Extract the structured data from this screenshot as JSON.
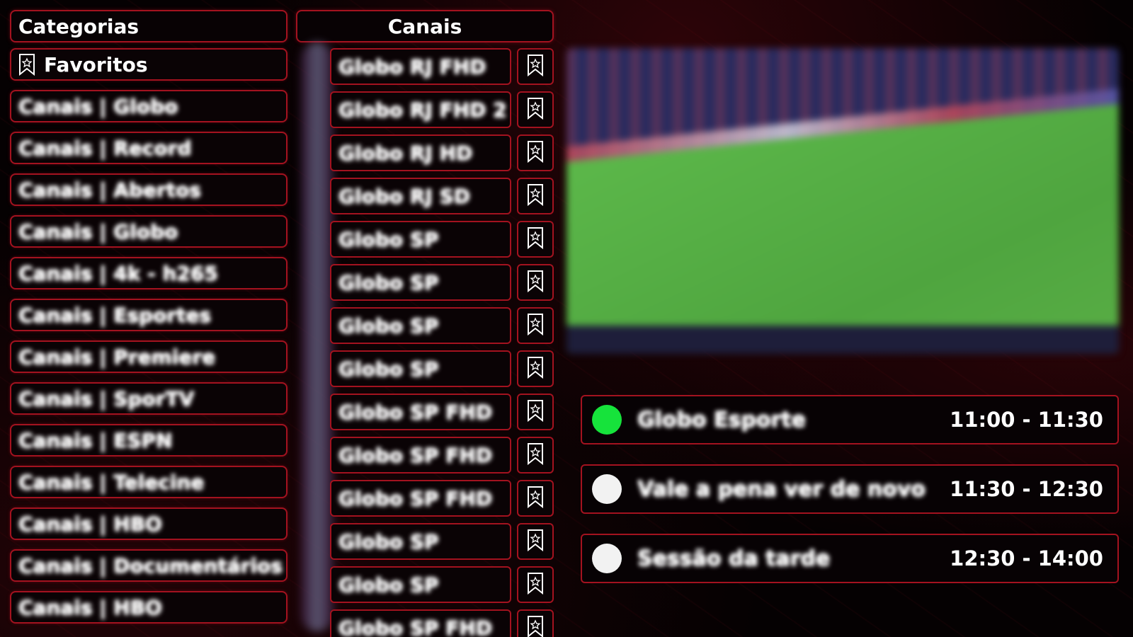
{
  "categories": {
    "title": "Categorias",
    "favorites_label": "Favoritos",
    "items": [
      "Canais | Globo",
      "Canais | Record",
      "Canais | Abertos",
      "Canais | Globo",
      "Canais | 4k - h265",
      "Canais | Esportes",
      "Canais | Premiere",
      "Canais | SporTV",
      "Canais | ESPN",
      "Canais | Telecine",
      "Canais | HBO",
      "Canais | Documentários",
      "Canais | HBO"
    ]
  },
  "channels": {
    "title": "Canais",
    "items": [
      "Globo RJ FHD",
      "Globo RJ FHD 2",
      "Globo RJ HD",
      "Globo RJ SD",
      "Globo SP",
      "Globo SP",
      "Globo SP",
      "Globo SP",
      "Globo SP FHD",
      "Globo SP FHD",
      "Globo SP FHD",
      "Globo SP",
      "Globo SP",
      "Globo SP FHD"
    ]
  },
  "epg": {
    "programs": [
      {
        "title": "Globo Esporte",
        "time": "11:00 - 11:30",
        "live": true
      },
      {
        "title": "Vale a pena ver de novo",
        "time": "11:30 - 12:30",
        "live": false
      },
      {
        "title": "Sessão da tarde",
        "time": "12:30 - 14:00",
        "live": false
      }
    ]
  },
  "theme": {
    "accent": "#a3121f",
    "live_indicator": "#16e33b",
    "background": "#050102"
  },
  "icons": {
    "favorite": "bookmark-star-icon"
  }
}
